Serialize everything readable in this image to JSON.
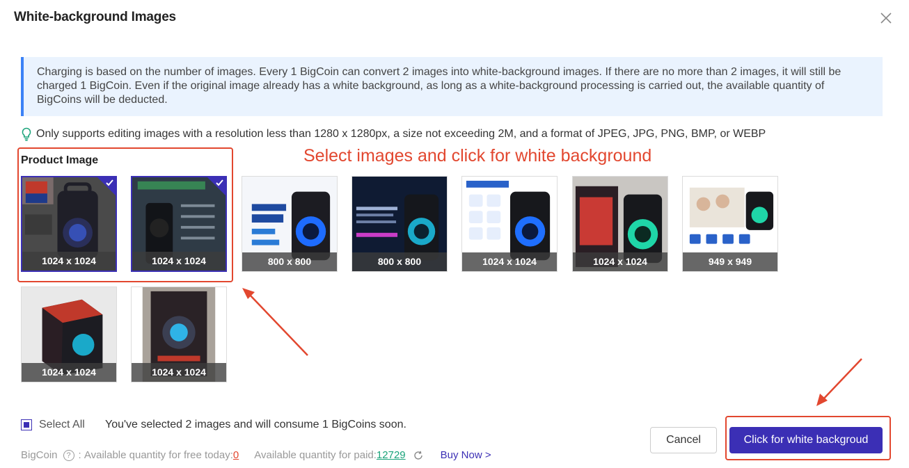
{
  "dialog": {
    "title": "White-background Images",
    "close_icon": "close-icon"
  },
  "notice": {
    "text": "Charging is based on the number of images. Every 1 BigCoin can convert 2 images into white-background images. If there are no more than 2 images, it will still be charged 1 BigCoin. Even if the original image already has a white background, as long as a white-background processing is carried out, the available quantity of BigCoins will be deducted."
  },
  "tip": {
    "icon": "lightbulb-icon",
    "text": "Only supports editing images with a resolution less than 1280 x 1280px, a size not exceeding 2M, and a format of JPEG, JPG, PNG, BMP, or WEBP"
  },
  "annotation": {
    "text": "Select images and click for white background",
    "color": "#e2472f"
  },
  "section": {
    "label": "Product Image"
  },
  "images": [
    {
      "dims": "1024 x 1024",
      "selected": true
    },
    {
      "dims": "1024 x 1024",
      "selected": true
    },
    {
      "dims": "800 x 800",
      "selected": false
    },
    {
      "dims": "800 x 800",
      "selected": false
    },
    {
      "dims": "1024 x 1024",
      "selected": false
    },
    {
      "dims": "1024 x 1024",
      "selected": false
    },
    {
      "dims": "949 x 949",
      "selected": false
    },
    {
      "dims": "1024 x 1024",
      "selected": false
    },
    {
      "dims": "1024 x 1024",
      "selected": false
    }
  ],
  "footer": {
    "select_all": "Select All",
    "selected_message": "You've selected 2 images and will consume 1 BigCoins soon.",
    "bigcoin_label": "BigCoin",
    "free_label": "Available quantity for free today: ",
    "free_value": "0",
    "paid_label": "Available quantity for paid: ",
    "paid_value": "12729",
    "buy_now": "Buy Now >",
    "cancel": "Cancel",
    "primary": "Click for white backgroud"
  },
  "colors": {
    "accent": "#3b2fb5",
    "notice_bg": "#eaf3fe",
    "notice_bar": "#3b82f6",
    "annotation_red": "#e2472f",
    "link_green": "#1aa37a"
  }
}
